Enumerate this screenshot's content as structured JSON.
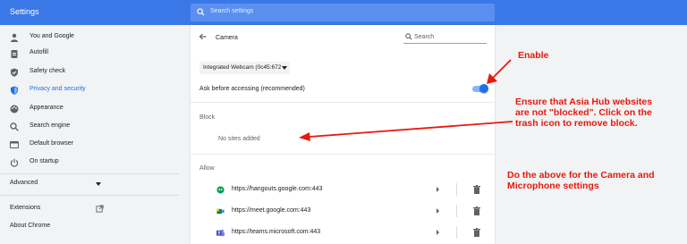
{
  "app": {
    "title": "Settings"
  },
  "search": {
    "placeholder": "Search settings"
  },
  "sidebar": {
    "items": [
      {
        "label": "You and Google",
        "icon": "person-icon",
        "active": false
      },
      {
        "label": "Autofill",
        "icon": "clipboard-icon",
        "active": false
      },
      {
        "label": "Safety check",
        "icon": "shield-check-icon",
        "active": false
      },
      {
        "label": "Privacy and security",
        "icon": "shield-icon",
        "active": true
      },
      {
        "label": "Appearance",
        "icon": "palette-icon",
        "active": false
      },
      {
        "label": "Search engine",
        "icon": "search-icon",
        "active": false
      },
      {
        "label": "Default browser",
        "icon": "browser-icon",
        "active": false
      },
      {
        "label": "On startup",
        "icon": "power-icon",
        "active": false
      }
    ],
    "advanced": "Advanced",
    "extensions": "Extensions",
    "about": "About Chrome"
  },
  "card": {
    "title": "Camera",
    "search_placeholder": "Search",
    "device": "Integrated Webcam (0c45:672",
    "ask_label": "Ask before accessing (recommended)",
    "toggle_on": true,
    "block_title": "Block",
    "block_empty": "No sites added",
    "allow_title": "Allow",
    "allow_sites": [
      {
        "url": "https://hangouts.google.com:443",
        "icon": "hangouts-icon"
      },
      {
        "url": "https://meet.google.com:443",
        "icon": "meet-icon"
      },
      {
        "url": "https://teams.microsoft.com:443",
        "icon": "teams-icon"
      }
    ]
  },
  "annotations": {
    "enable": "Enable",
    "ensure_lines": [
      "Ensure that Asia Hub websites",
      "are not \"blocked\". Click on the",
      "trash icon to remove block."
    ],
    "repeat_lines": [
      "Do the above for the Camera and",
      "Microphone settings"
    ]
  },
  "colors": {
    "topbar": "#3b78e7",
    "accent": "#1a73e8",
    "annotation": "#e8190e"
  }
}
